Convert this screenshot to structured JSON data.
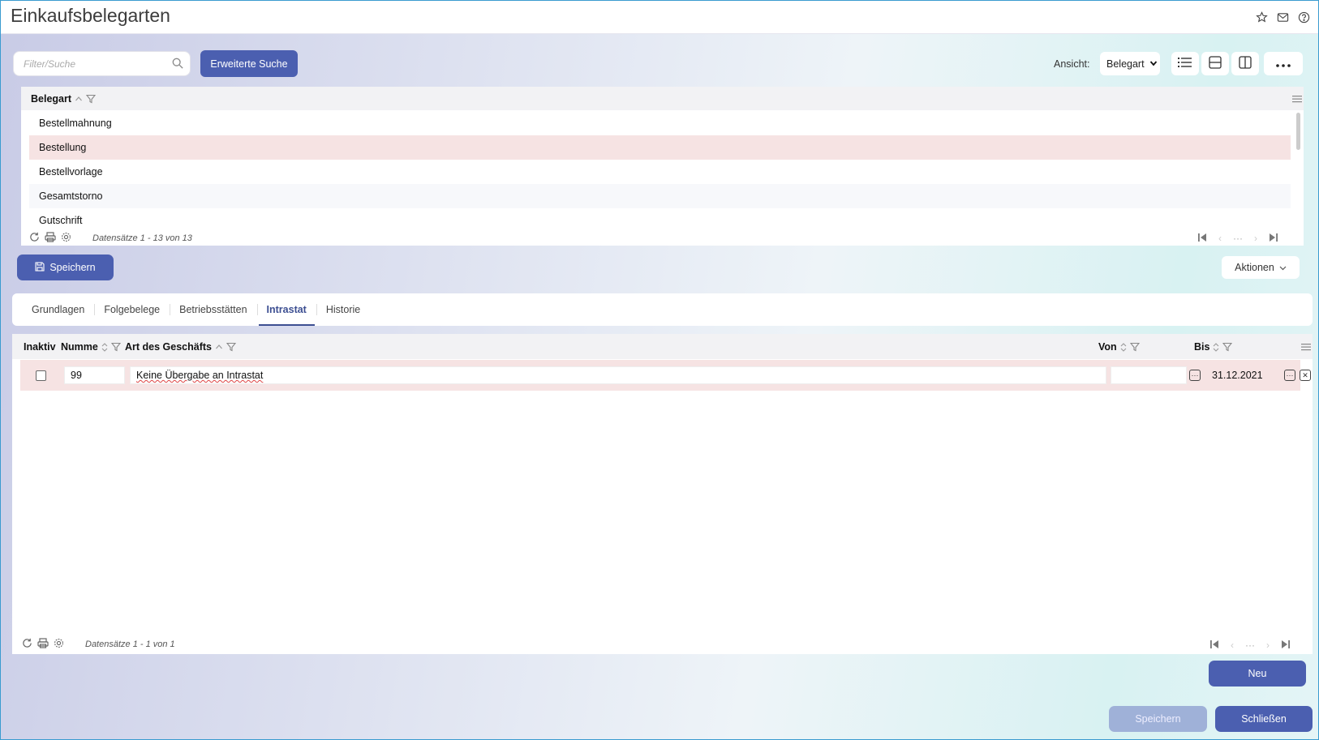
{
  "app": {
    "title": "Einkaufsbelegarten"
  },
  "search": {
    "placeholder": "Filter/Suche",
    "advanced_label": "Erweiterte Suche"
  },
  "view": {
    "label": "Ansicht:",
    "selected": "Belegart"
  },
  "upper_grid": {
    "column_header": "Belegart",
    "rows": [
      "Bestellmahnung",
      "Bestellung",
      "Bestellvorlage",
      "Gesamtstorno",
      "Gutschrift"
    ],
    "selected_row": "Bestellung",
    "records_info": "Datensätze 1 - 13 von 13"
  },
  "toolbar": {
    "save_label": "Speichern",
    "actions_label": "Aktionen"
  },
  "tabs": [
    "Grundlagen",
    "Folgebelege",
    "Betriebsstätten",
    "Intrastat",
    "Historie"
  ],
  "active_tab": "Intrastat",
  "lower_grid": {
    "headers": {
      "inaktiv": "Inaktiv",
      "nummer": "Numme",
      "art": "Art des Geschäfts",
      "von": "Von",
      "bis": "Bis"
    },
    "rows": [
      {
        "inaktiv": false,
        "nummer": "99",
        "art": "Keine Übergabe an Intrastat",
        "von": "",
        "bis": "31.12.2021"
      }
    ],
    "records_info": "Datensätze 1 - 1 von 1"
  },
  "footer": {
    "new_label": "Neu",
    "save_label": "Speichern",
    "close_label": "Schließen"
  },
  "colors": {
    "primary": "#4b5fb0",
    "selected_row": "#f6e3e3",
    "active_tab": "#3d4f92"
  }
}
